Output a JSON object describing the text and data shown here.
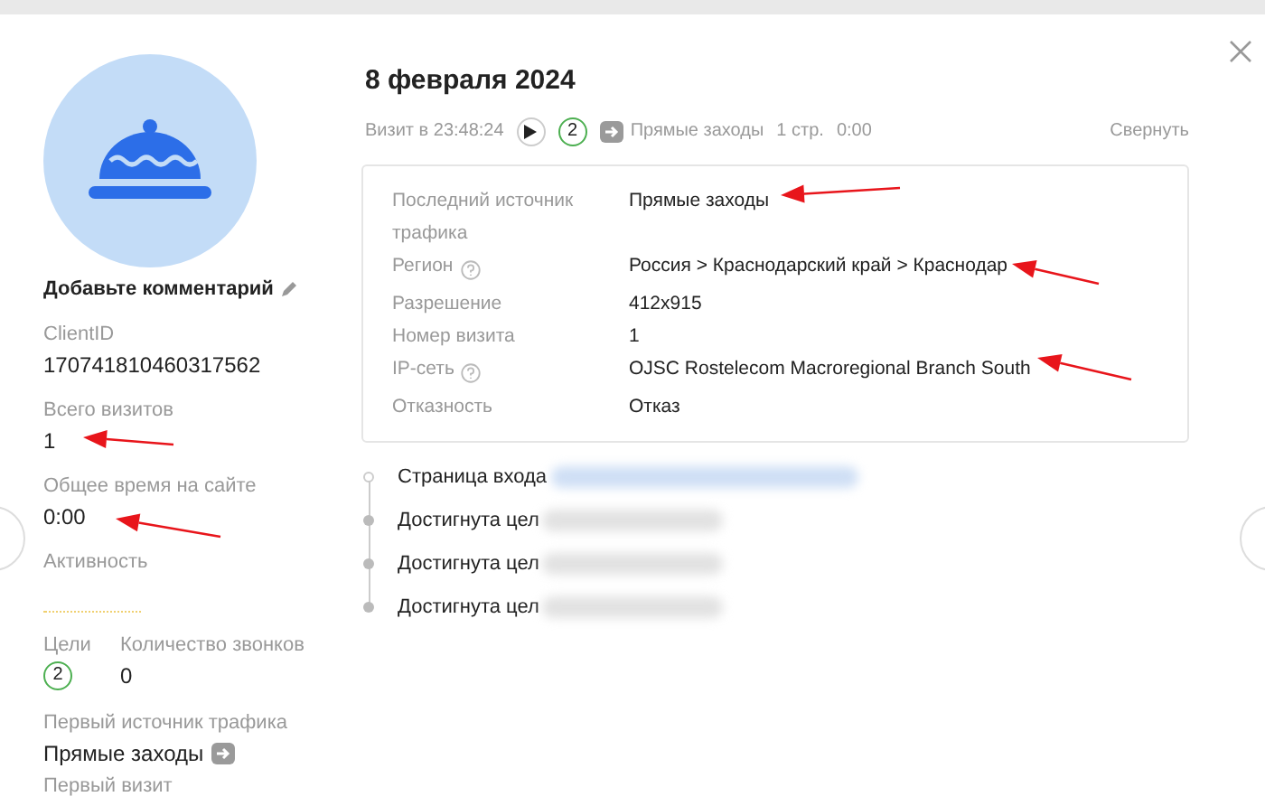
{
  "profile": {
    "comment": "Добавьте комментарий",
    "fields": [
      {
        "label": "ClientID",
        "value": "170741810460317562"
      },
      {
        "label": "Всего визитов",
        "value": "1"
      },
      {
        "label": "Общее время на сайте",
        "value": "0:00"
      }
    ],
    "activity_label": "Активность",
    "goals": {
      "label": "Цели",
      "value": "2"
    },
    "calls": {
      "label": "Количество звонков",
      "value": "0"
    },
    "first_source": {
      "label": "Первый источник трафика",
      "value": "Прямые заходы"
    },
    "first_visit_label": "Первый визит"
  },
  "visit": {
    "date": "8 февраля 2024",
    "time": "Визит в 23:48:24",
    "goals": "2",
    "source": "Прямые заходы",
    "pages": "1 стр.",
    "duration": "0:00",
    "collapse": "Свернуть",
    "details": [
      {
        "label": "Последний источник трафика",
        "value": "Прямые заходы",
        "help": false
      },
      {
        "label": "Регион",
        "value": "Россия > Краснодарский край > Краснодар",
        "help": true
      },
      {
        "label": "Разрешение",
        "value": "412x915",
        "help": false
      },
      {
        "label": "Номер визита",
        "value": "1",
        "help": false
      },
      {
        "label": "IP-сеть",
        "value": "OJSC Rostelecom Macroregional Branch South",
        "help": true
      },
      {
        "label": "Отказность",
        "value": "Отказ",
        "help": false
      }
    ],
    "timeline": [
      {
        "kind": "entry",
        "label": "Страница входа"
      },
      {
        "kind": "goal",
        "label": "Достигнута цел"
      },
      {
        "kind": "goal",
        "label": "Достигнута цел"
      },
      {
        "kind": "goal",
        "label": "Достигнута цел"
      }
    ]
  }
}
